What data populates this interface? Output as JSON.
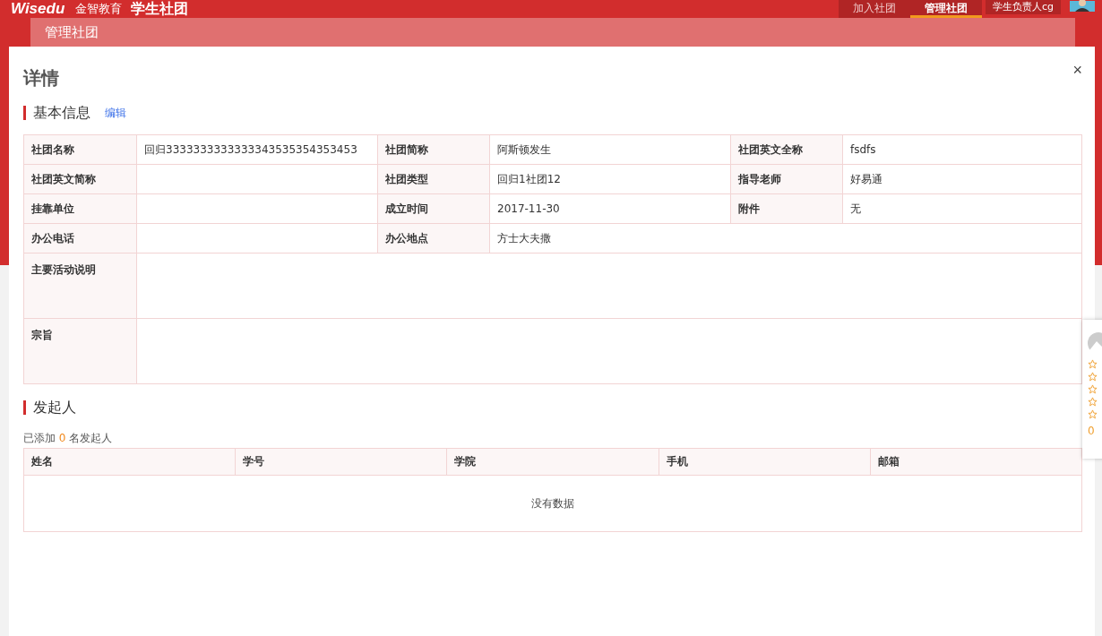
{
  "header": {
    "logo": "Wisedu",
    "brand": "金智教育",
    "app_title": "学生社团",
    "nav": [
      {
        "label": "加入社团",
        "selected": false
      },
      {
        "label": "管理社团",
        "selected": true
      }
    ],
    "user": "学生负责人cg"
  },
  "breadcrumb": "管理社团",
  "dialog": {
    "title": "详情",
    "close": "×",
    "basic": {
      "heading": "基本信息",
      "edit_link": "编辑",
      "rows": [
        [
          {
            "label": "社团名称",
            "value": "回归3333333333333343535354353453"
          },
          {
            "label": "社团简称",
            "value": "阿斯顿发生"
          },
          {
            "label": "社团英文全称",
            "value": "fsdfs"
          }
        ],
        [
          {
            "label": "社团英文简称"
          },
          {
            "label": "社团类型",
            "value": "回归1社团12"
          },
          {
            "label": "指导老师",
            "value": "好易通"
          }
        ],
        [
          {
            "label": "挂靠单位"
          },
          {
            "label": "成立时间",
            "value": "2017-11-30"
          },
          {
            "label": "附件",
            "value": "无"
          }
        ],
        [
          {
            "label": "办公电话"
          },
          {
            "label": "办公地点",
            "value": "方士大夫撒"
          }
        ],
        [
          {
            "label": "主要活动说明"
          }
        ],
        [
          {
            "label": "宗旨"
          }
        ]
      ]
    },
    "founders": {
      "heading": "发起人",
      "count_prefix": "已添加",
      "count": "0",
      "count_suffix": "名发起人",
      "columns": [
        "姓名",
        "学号",
        "学院",
        "手机",
        "邮箱"
      ],
      "empty_text": "没有数据"
    }
  },
  "side_widget": {
    "count": "0"
  }
}
